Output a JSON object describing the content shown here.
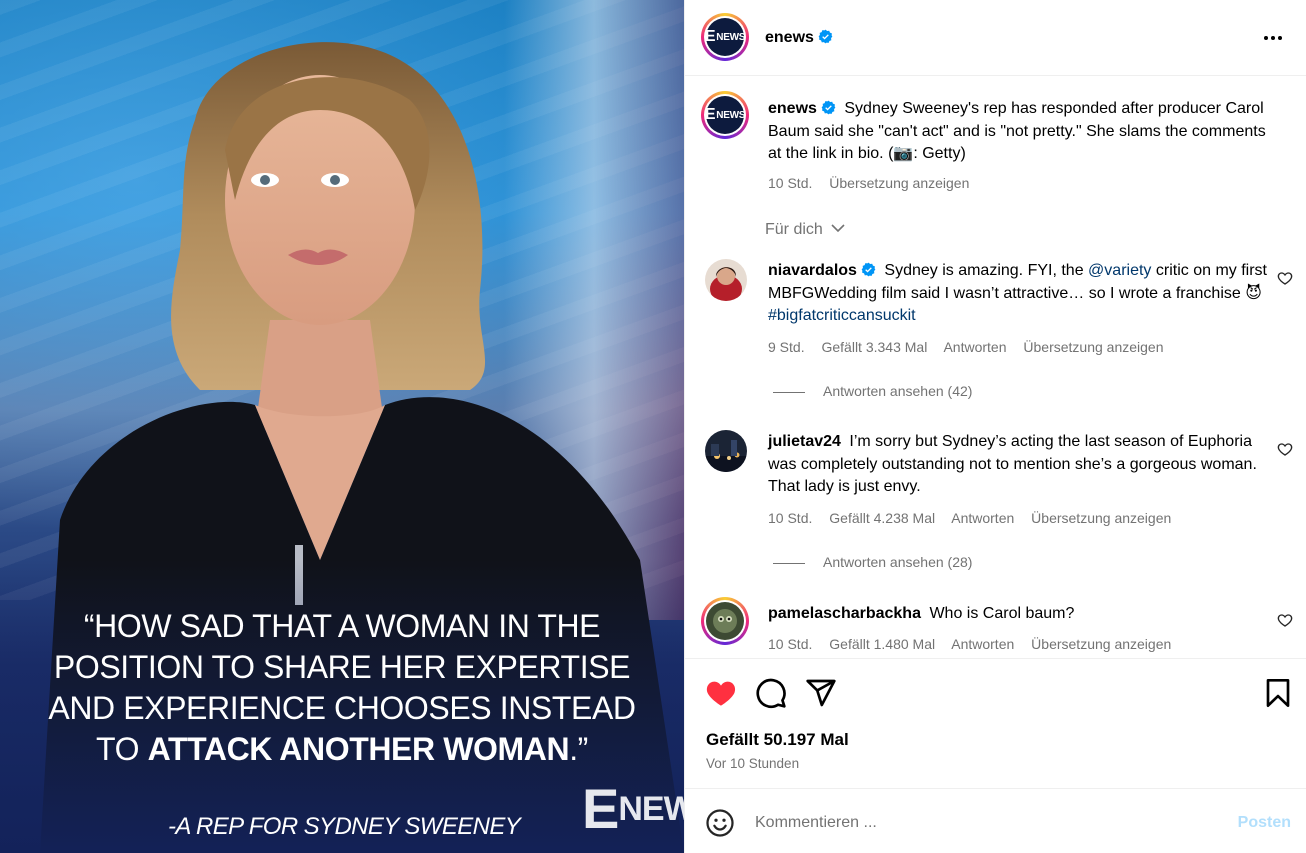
{
  "media": {
    "quote_line1": "“HOW SAD THAT A WOMAN IN THE",
    "quote_line2": "POSITION TO SHARE HER EXPERTISE",
    "quote_line3": "AND EXPERIENCE CHOOSES INSTEAD",
    "quote_line4_pre": "TO ",
    "quote_line4_bold": "ATTACK ANOTHER WOMAN",
    "quote_line4_post": ".”",
    "attribution": "-A REP FOR SYDNEY SWEENEY",
    "watermark_e": "E",
    "watermark_news": "NEWS"
  },
  "header": {
    "username": "enews",
    "avatar_letter": "E",
    "avatar_text": "NEWS",
    "more_icon": "more-horizontal-icon"
  },
  "caption": {
    "username": "enews",
    "text": "Sydney Sweeney's rep has responded after producer Carol Baum said she \"can't act\" and is \"not pretty.\" She slams the comments at the link in bio. (📷: Getty)",
    "time": "10 Std.",
    "translate": "Übersetzung anzeigen"
  },
  "for_you": "Für dich",
  "comments": [
    {
      "username": "niavardalos",
      "verified": true,
      "text_pre": "Sydney is amazing. FYI, the ",
      "mention": "@variety",
      "text_mid": " critic on my first MBFGWedding film said I wasn’t attractive… so I wrote a franchise 😈 ",
      "hashtag": "#bigfatcriticcansuckit",
      "time": "9 Std.",
      "likes": "Gefällt 3.343 Mal",
      "reply": "Antworten",
      "translate": "Übersetzung anzeigen",
      "view_replies": "Antworten ansehen (42)"
    },
    {
      "username": "julietav24",
      "verified": false,
      "text": "I’m sorry but Sydney’s acting the last season of Euphoria was completely outstanding not to mention she’s a gorgeous woman. That lady is just envy.",
      "time": "10 Std.",
      "likes": "Gefällt 4.238 Mal",
      "reply": "Antworten",
      "translate": "Übersetzung anzeigen",
      "view_replies": "Antworten ansehen (28)"
    },
    {
      "username": "pamelascharbackha",
      "verified": false,
      "text": "Who is Carol baum?",
      "time": "10 Std.",
      "likes": "Gefällt 1.480 Mal",
      "reply": "Antworten",
      "translate": "Übersetzung anzeigen"
    }
  ],
  "actions": {
    "liked": true,
    "like_color": "#ff3040",
    "likes_text": "Gefällt 50.197 Mal",
    "posted": "Vor 10 Stunden"
  },
  "composer": {
    "placeholder": "Kommentieren ...",
    "post_label": "Posten",
    "post_color": "#b2dffc"
  }
}
